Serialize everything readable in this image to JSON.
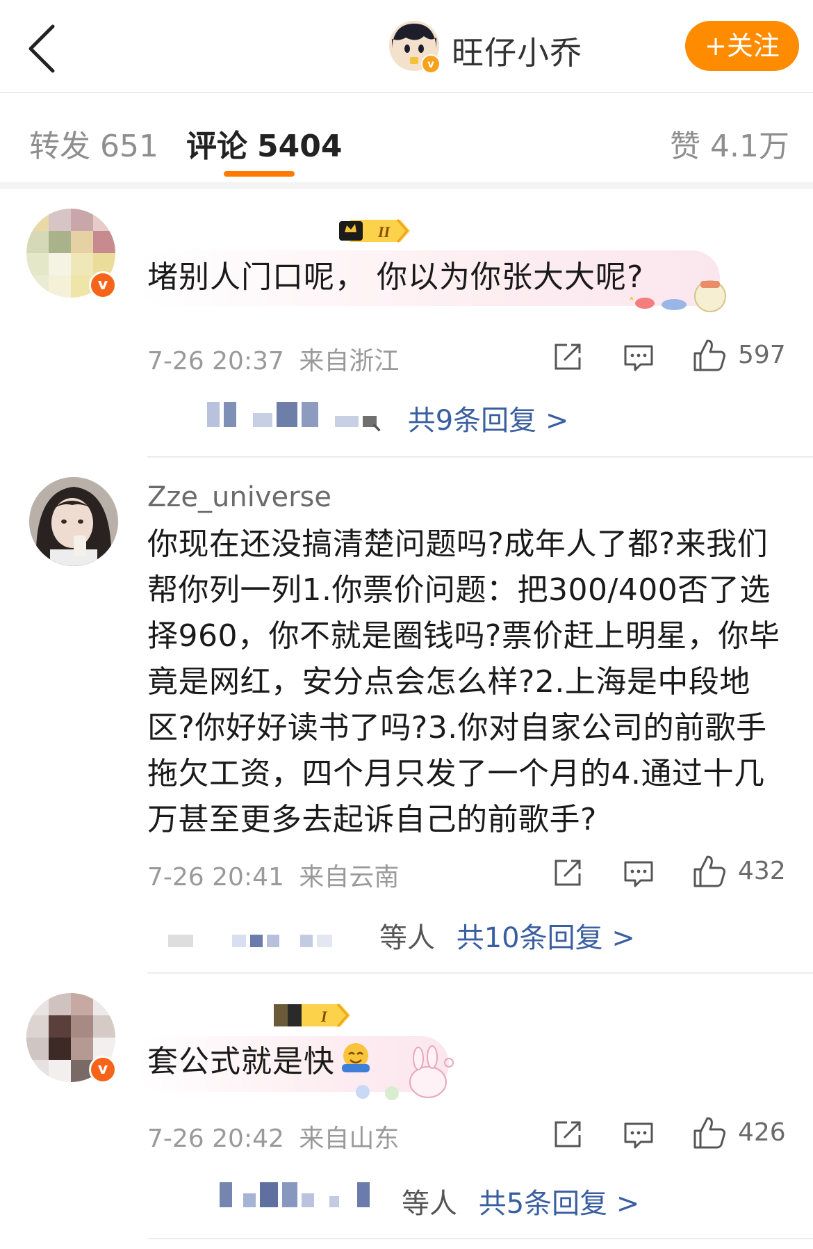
{
  "header": {
    "author_name": "旺仔小乔",
    "follow_label": "+关注",
    "verified_mark": "v"
  },
  "tabs": {
    "repost_label": "转发",
    "repost_count": "651",
    "comment_label": "评论",
    "comment_count": "5404",
    "like_label": "赞",
    "like_count": "4.1万"
  },
  "comments": [
    {
      "username": "",
      "text": "堵别人门口呢， 你以为你张大大呢?",
      "time": "7-26 20:37",
      "location": "来自浙江",
      "likes": "597",
      "reply_prefix": "、",
      "reply_summary": "共9条回复 >",
      "badge_level": "II",
      "verified_mark": "v"
    },
    {
      "username": "Zze_universe",
      "text": "你现在还没搞清楚问题吗?成年人了都?来我们帮你列一列1.你票价问题：把300/400否了选择960，你不就是圈钱吗?票价赶上明星，你毕竟是网红，安分点会怎么样?2.上海是中段地区?你好好读书了吗?3.你对自家公司的前歌手拖欠工资，四个月只发了一个月的4.通过十几万甚至更多去起诉自己的前歌手?",
      "time": "7-26 20:41",
      "location": "来自云南",
      "likes": "432",
      "reply_prefix": "等人",
      "reply_summary": "共10条回复 >"
    },
    {
      "username": "",
      "text": "套公式就是快",
      "time": "7-26 20:42",
      "location": "来自山东",
      "likes": "426",
      "reply_prefix": "等人",
      "reply_summary": "共5条回复 >",
      "badge_level": "I",
      "verified_mark": "v"
    }
  ],
  "icons": {
    "back": "chevron-left-icon",
    "repost": "share-icon",
    "comment": "comment-icon",
    "like": "thumbs-up-icon"
  },
  "colors": {
    "accent_orange": "#ff8c00",
    "tab_underline": "#ff7a00",
    "link_blue": "#3a5fa0",
    "verified_badge": "#f6641a"
  }
}
